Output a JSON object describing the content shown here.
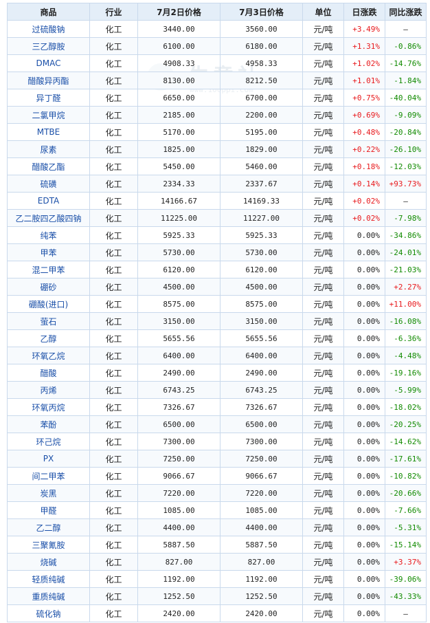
{
  "watermark": {
    "text": "生意社",
    "url": "www.100ppi.com"
  },
  "headers": {
    "name": "商品",
    "industry": "行业",
    "price_prev": "7月2日价格",
    "price_curr": "7月3日价格",
    "unit": "单位",
    "daily": "日涨跌",
    "yoy": "同比涨跌"
  },
  "rows": [
    {
      "name": "过硫酸钠",
      "industry": "化工",
      "price_prev": "3440.00",
      "price_curr": "3560.00",
      "unit": "元/吨",
      "daily": "+3.49%",
      "yoy": "—"
    },
    {
      "name": "三乙醇胺",
      "industry": "化工",
      "price_prev": "6100.00",
      "price_curr": "6180.00",
      "unit": "元/吨",
      "daily": "+1.31%",
      "yoy": "-0.86%"
    },
    {
      "name": "DMAC",
      "industry": "化工",
      "price_prev": "4908.33",
      "price_curr": "4958.33",
      "unit": "元/吨",
      "daily": "+1.02%",
      "yoy": "-14.76%"
    },
    {
      "name": "醋酸异丙酯",
      "industry": "化工",
      "price_prev": "8130.00",
      "price_curr": "8212.50",
      "unit": "元/吨",
      "daily": "+1.01%",
      "yoy": "-1.84%"
    },
    {
      "name": "异丁醛",
      "industry": "化工",
      "price_prev": "6650.00",
      "price_curr": "6700.00",
      "unit": "元/吨",
      "daily": "+0.75%",
      "yoy": "-40.04%"
    },
    {
      "name": "二氯甲烷",
      "industry": "化工",
      "price_prev": "2185.00",
      "price_curr": "2200.00",
      "unit": "元/吨",
      "daily": "+0.69%",
      "yoy": "-9.09%"
    },
    {
      "name": "MTBE",
      "industry": "化工",
      "price_prev": "5170.00",
      "price_curr": "5195.00",
      "unit": "元/吨",
      "daily": "+0.48%",
      "yoy": "-20.84%"
    },
    {
      "name": "尿素",
      "industry": "化工",
      "price_prev": "1825.00",
      "price_curr": "1829.00",
      "unit": "元/吨",
      "daily": "+0.22%",
      "yoy": "-26.10%"
    },
    {
      "name": "醋酸乙酯",
      "industry": "化工",
      "price_prev": "5450.00",
      "price_curr": "5460.00",
      "unit": "元/吨",
      "daily": "+0.18%",
      "yoy": "-12.03%"
    },
    {
      "name": "硫磺",
      "industry": "化工",
      "price_prev": "2334.33",
      "price_curr": "2337.67",
      "unit": "元/吨",
      "daily": "+0.14%",
      "yoy": "+93.73%"
    },
    {
      "name": "EDTA",
      "industry": "化工",
      "price_prev": "14166.67",
      "price_curr": "14169.33",
      "unit": "元/吨",
      "daily": "+0.02%",
      "yoy": "—"
    },
    {
      "name": "乙二胺四乙酸四钠",
      "industry": "化工",
      "price_prev": "11225.00",
      "price_curr": "11227.00",
      "unit": "元/吨",
      "daily": "+0.02%",
      "yoy": "-7.98%"
    },
    {
      "name": "纯苯",
      "industry": "化工",
      "price_prev": "5925.33",
      "price_curr": "5925.33",
      "unit": "元/吨",
      "daily": "0.00%",
      "yoy": "-34.86%"
    },
    {
      "name": "甲苯",
      "industry": "化工",
      "price_prev": "5730.00",
      "price_curr": "5730.00",
      "unit": "元/吨",
      "daily": "0.00%",
      "yoy": "-24.01%"
    },
    {
      "name": "混二甲苯",
      "industry": "化工",
      "price_prev": "6120.00",
      "price_curr": "6120.00",
      "unit": "元/吨",
      "daily": "0.00%",
      "yoy": "-21.03%"
    },
    {
      "name": "硼砂",
      "industry": "化工",
      "price_prev": "4500.00",
      "price_curr": "4500.00",
      "unit": "元/吨",
      "daily": "0.00%",
      "yoy": "+2.27%"
    },
    {
      "name": "硼酸(进口)",
      "industry": "化工",
      "price_prev": "8575.00",
      "price_curr": "8575.00",
      "unit": "元/吨",
      "daily": "0.00%",
      "yoy": "+11.00%"
    },
    {
      "name": "萤石",
      "industry": "化工",
      "price_prev": "3150.00",
      "price_curr": "3150.00",
      "unit": "元/吨",
      "daily": "0.00%",
      "yoy": "-16.08%"
    },
    {
      "name": "乙醇",
      "industry": "化工",
      "price_prev": "5655.56",
      "price_curr": "5655.56",
      "unit": "元/吨",
      "daily": "0.00%",
      "yoy": "-6.36%"
    },
    {
      "name": "环氧乙烷",
      "industry": "化工",
      "price_prev": "6400.00",
      "price_curr": "6400.00",
      "unit": "元/吨",
      "daily": "0.00%",
      "yoy": "-4.48%"
    },
    {
      "name": "醋酸",
      "industry": "化工",
      "price_prev": "2490.00",
      "price_curr": "2490.00",
      "unit": "元/吨",
      "daily": "0.00%",
      "yoy": "-19.16%"
    },
    {
      "name": "丙烯",
      "industry": "化工",
      "price_prev": "6743.25",
      "price_curr": "6743.25",
      "unit": "元/吨",
      "daily": "0.00%",
      "yoy": "-5.99%"
    },
    {
      "name": "环氧丙烷",
      "industry": "化工",
      "price_prev": "7326.67",
      "price_curr": "7326.67",
      "unit": "元/吨",
      "daily": "0.00%",
      "yoy": "-18.02%"
    },
    {
      "name": "苯酚",
      "industry": "化工",
      "price_prev": "6500.00",
      "price_curr": "6500.00",
      "unit": "元/吨",
      "daily": "0.00%",
      "yoy": "-20.25%"
    },
    {
      "name": "环己烷",
      "industry": "化工",
      "price_prev": "7300.00",
      "price_curr": "7300.00",
      "unit": "元/吨",
      "daily": "0.00%",
      "yoy": "-14.62%"
    },
    {
      "name": "PX",
      "industry": "化工",
      "price_prev": "7250.00",
      "price_curr": "7250.00",
      "unit": "元/吨",
      "daily": "0.00%",
      "yoy": "-17.61%"
    },
    {
      "name": "间二甲苯",
      "industry": "化工",
      "price_prev": "9066.67",
      "price_curr": "9066.67",
      "unit": "元/吨",
      "daily": "0.00%",
      "yoy": "-10.82%"
    },
    {
      "name": "炭黑",
      "industry": "化工",
      "price_prev": "7220.00",
      "price_curr": "7220.00",
      "unit": "元/吨",
      "daily": "0.00%",
      "yoy": "-20.66%"
    },
    {
      "name": "甲醛",
      "industry": "化工",
      "price_prev": "1085.00",
      "price_curr": "1085.00",
      "unit": "元/吨",
      "daily": "0.00%",
      "yoy": "-7.66%"
    },
    {
      "name": "乙二醇",
      "industry": "化工",
      "price_prev": "4400.00",
      "price_curr": "4400.00",
      "unit": "元/吨",
      "daily": "0.00%",
      "yoy": "-5.31%"
    },
    {
      "name": "三聚氰胺",
      "industry": "化工",
      "price_prev": "5887.50",
      "price_curr": "5887.50",
      "unit": "元/吨",
      "daily": "0.00%",
      "yoy": "-15.14%"
    },
    {
      "name": "烧碱",
      "industry": "化工",
      "price_prev": "827.00",
      "price_curr": "827.00",
      "unit": "元/吨",
      "daily": "0.00%",
      "yoy": "+3.37%"
    },
    {
      "name": "轻质纯碱",
      "industry": "化工",
      "price_prev": "1192.00",
      "price_curr": "1192.00",
      "unit": "元/吨",
      "daily": "0.00%",
      "yoy": "-39.06%"
    },
    {
      "name": "重质纯碱",
      "industry": "化工",
      "price_prev": "1252.50",
      "price_curr": "1252.50",
      "unit": "元/吨",
      "daily": "0.00%",
      "yoy": "-43.33%"
    },
    {
      "name": "硫化钠",
      "industry": "化工",
      "price_prev": "2420.00",
      "price_curr": "2420.00",
      "unit": "元/吨",
      "daily": "0.00%",
      "yoy": "—"
    }
  ],
  "colors": {
    "up": "#e8191c",
    "down": "#118a00",
    "header_bg": "#e4eef8",
    "border": "#c9d9ec",
    "name_link": "#1a4fa8"
  }
}
